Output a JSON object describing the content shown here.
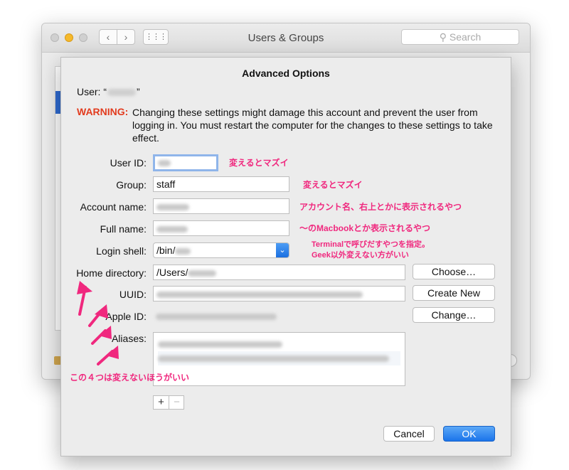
{
  "window": {
    "title": "Users & Groups",
    "search_placeholder": "Search",
    "back_icon": "‹",
    "forward_icon": "›",
    "grid_icon": "⋮⋮⋮"
  },
  "sheet": {
    "title": "Advanced Options",
    "user_prefix": "User: “",
    "user_suffix": "”",
    "warning_label": "WARNING:",
    "warning_text": "Changing these settings might damage this account and prevent the user from logging in. You must restart the computer for the changes to these settings to take effect."
  },
  "fields": {
    "user_id_label": "User ID:",
    "group_label": "Group:",
    "group_value": "staff",
    "account_name_label": "Account name:",
    "full_name_label": "Full name:",
    "login_shell_label": "Login shell:",
    "login_shell_value": "/bin/",
    "home_dir_label": "Home directory:",
    "home_dir_value": "/Users/",
    "uuid_label": "UUID:",
    "apple_id_label": "Apple ID:",
    "aliases_label": "Aliases:"
  },
  "buttons": {
    "choose": "Choose…",
    "create_new": "Create New",
    "change": "Change…",
    "plus": "+",
    "minus": "−",
    "cancel": "Cancel",
    "ok": "OK",
    "dropdown_arrow": "⌄"
  },
  "annotations": {
    "user_id_note": "変えるとマズイ",
    "group_note": "変えるとマズイ",
    "account_note": "アカウント名、右上とかに表示されるやつ",
    "full_name_note": "〜のMacbookとか表示されるやつ",
    "shell_note_1": "Terminalで呼びだすやつを指定。",
    "shell_note_2": "Geek以外変えない方がいい",
    "bottom_note": "この４つは変えないほうがいい",
    "accent_color": "#f0287e"
  }
}
